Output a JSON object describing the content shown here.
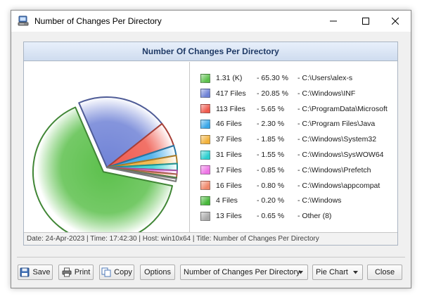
{
  "window": {
    "title": "Number of Changes Per Directory"
  },
  "panel": {
    "header": "Number Of Changes Per Directory",
    "footer": "Date: 24-Apr-2023 | Time: 17:42:30 | Host: win10x64 | Title: Number of Changes Per Directory"
  },
  "legend": [
    {
      "count": "1.31 (K)",
      "percent": "- 65.30 %",
      "path": "- C:\\Users\\alex-s",
      "color": "#5cc04c"
    },
    {
      "count": "417 Files",
      "percent": "- 20.85 %",
      "path": "- C:\\Windows\\INF",
      "color": "#6f82d6"
    },
    {
      "count": "113 Files",
      "percent": "- 5.65 %",
      "path": "- C:\\ProgramData\\Microsoft",
      "color": "#ef5a4e"
    },
    {
      "count": "46 Files",
      "percent": "- 2.30 %",
      "path": "- C:\\Program Files\\Java",
      "color": "#3aa7e8"
    },
    {
      "count": "37 Files",
      "percent": "- 1.85 %",
      "path": "- C:\\Windows\\System32",
      "color": "#f2b13a"
    },
    {
      "count": "31 Files",
      "percent": "- 1.55 %",
      "path": "- C:\\Windows\\SysWOW64",
      "color": "#2ccfcf"
    },
    {
      "count": "17 Files",
      "percent": "- 0.85 %",
      "path": "- C:\\Windows\\Prefetch",
      "color": "#ee74e6"
    },
    {
      "count": "16 Files",
      "percent": "- 0.80 %",
      "path": "- C:\\Windows\\appcompat",
      "color": "#f0876a"
    },
    {
      "count": "4 Files",
      "percent": "- 0.20 %",
      "path": "- C:\\Windows",
      "color": "#47b83a"
    },
    {
      "count": "13 Files",
      "percent": "- 0.65 %",
      "path": "- Other (8)",
      "color": "#a9a9a9"
    }
  ],
  "chart_data": {
    "type": "pie",
    "slices": [
      {
        "label": "C:\\Users\\alex-s",
        "value": 65.3,
        "color": "#5cc04c"
      },
      {
        "label": "C:\\Windows\\INF",
        "value": 20.85,
        "color": "#6f82d6"
      },
      {
        "label": "C:\\ProgramData\\Microsoft",
        "value": 5.65,
        "color": "#ef5a4e"
      },
      {
        "label": "C:\\Program Files\\Java",
        "value": 2.3,
        "color": "#3aa7e8"
      },
      {
        "label": "C:\\Windows\\System32",
        "value": 1.85,
        "color": "#f2b13a"
      },
      {
        "label": "C:\\Windows\\SysWOW64",
        "value": 1.55,
        "color": "#2ccfcf"
      },
      {
        "label": "C:\\Windows\\Prefetch",
        "value": 0.85,
        "color": "#ee74e6"
      },
      {
        "label": "C:\\Windows\\appcompat",
        "value": 0.8,
        "color": "#f0876a"
      },
      {
        "label": "C:\\Windows",
        "value": 0.2,
        "color": "#47b83a"
      },
      {
        "label": "Other (8)",
        "value": 0.65,
        "color": "#a9a9a9"
      }
    ],
    "exploded_slice": "C:\\Users\\alex-s",
    "legend_placement": "right"
  },
  "toolbar": {
    "save_label": "Save",
    "print_label": "Print",
    "copy_label": "Copy",
    "options_label": "Options",
    "report_select": "Number of Changes Per Directory",
    "chart_type_select": "Pie Chart",
    "close_label": "Close"
  }
}
